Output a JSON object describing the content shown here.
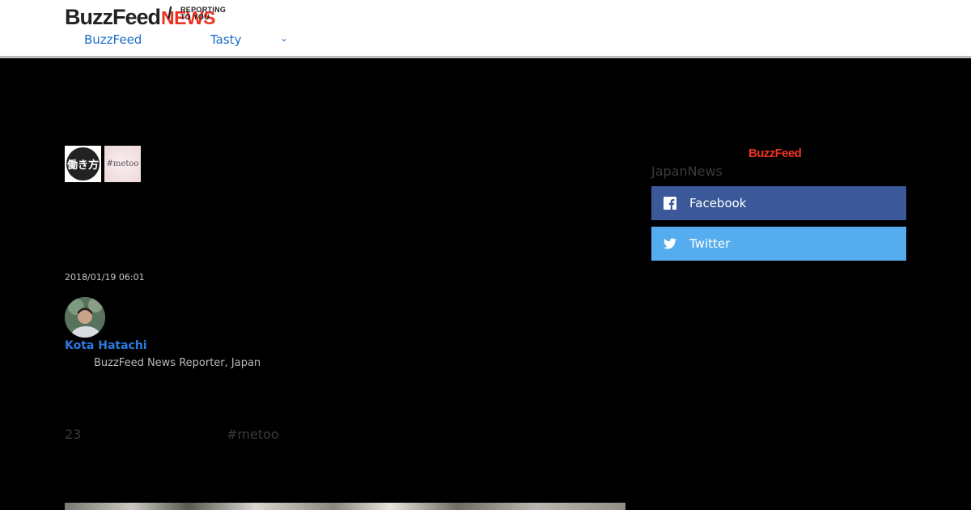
{
  "header": {
    "logo_brand": "BuzzFeed",
    "logo_news": "NEWS",
    "logo_slash": "/",
    "logo_tagline_1": "REPORTING",
    "logo_tagline_2": "TO YOU",
    "nav": [
      {
        "label": "BuzzFeed"
      },
      {
        "label": "Tasty"
      }
    ],
    "nav_more_chevron": "⌄"
  },
  "article": {
    "tag_thumbs": [
      {
        "label": "働き方"
      },
      {
        "label": "#metoo"
      }
    ],
    "date": "2018/01/19 06:01",
    "author": {
      "name": "Kota Hatachi",
      "role": "BuzzFeed News Reporter, Japan"
    },
    "stat_number": "23",
    "stat_hashtag": "#metoo"
  },
  "sidebar": {
    "logo": "BuzzFeed",
    "title": "JapanNews",
    "share": [
      {
        "label": "Facebook",
        "icon": "facebook-icon",
        "color": "#3b5998"
      },
      {
        "label": "Twitter",
        "icon": "twitter-icon",
        "color": "#55acee"
      }
    ]
  },
  "colors": {
    "accent_red": "#ee3322",
    "link_blue": "#1a6dcc",
    "background_dark": "#000000"
  }
}
